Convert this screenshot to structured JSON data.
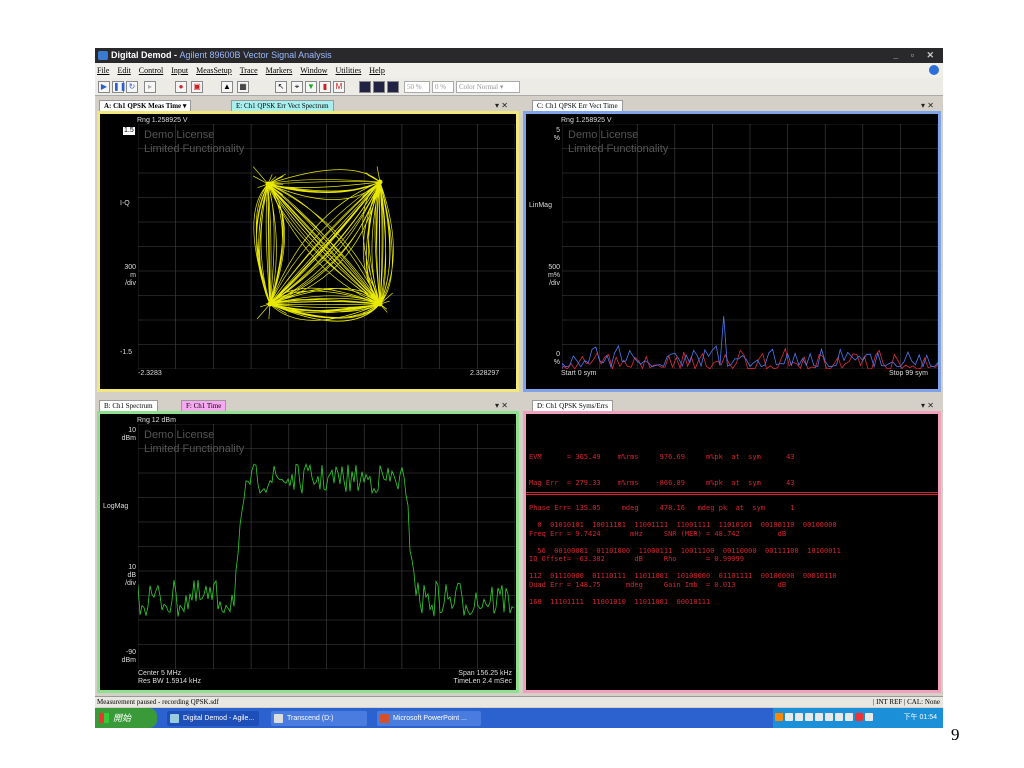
{
  "window": {
    "title": "Digital Demod",
    "app": "Agilent 89600B Vector Signal Analysis"
  },
  "menu": [
    "File",
    "Edit",
    "Control",
    "Input",
    "MeasSetup",
    "Trace",
    "Markers",
    "Window",
    "Utilities",
    "Help"
  ],
  "toolbar": {
    "field1": "50 %",
    "field2": "0 %",
    "color_select": "Color Normal"
  },
  "panelA": {
    "tab_active": "A: Ch1 QPSK Meas Time",
    "tab_other": "E: Ch1 QPSK Err Vect Spectrum",
    "rng": "Rng 1.258925  V",
    "ytop": "1.5",
    "ylabel": "I-Q",
    "scale": [
      "300",
      "m",
      "/div"
    ],
    "ybot": "-1.5",
    "xleft": "-2.3283",
    "xright": "2.328297"
  },
  "panelC": {
    "tab": "C: Ch1 QPSK Err Vect Time",
    "rng": "Rng 1.258925  V",
    "ytop": [
      "5",
      "%"
    ],
    "ylabel": "LinMag",
    "scale": [
      "500",
      "m%",
      "/div"
    ],
    "ybot": [
      "0",
      "%"
    ],
    "xleft": "Start 0  sym",
    "xright": "Stop 99  sym"
  },
  "panelB": {
    "tab_active": "B: Ch1 Spectrum",
    "tab_other": "F: Ch1 Time",
    "rng": "Rng 12 dBm",
    "ytop": [
      "10",
      "dBm"
    ],
    "ylabel": "LogMag",
    "scale": [
      "10",
      "dB",
      "/div"
    ],
    "ybot": [
      "-90",
      "dBm"
    ],
    "center": "Center 5 MHz",
    "resbw": "Res BW 1.5914 kHz",
    "span": "Span 156.25 kHz",
    "timelen": "TimeLen 2.4 mSec"
  },
  "panelD": {
    "tab": "D: Ch1 QPSK Syms/Errs",
    "metrics": [
      "EVM      = 365.49    m%rms     976.69     m%pk  at  sym      43",
      "Mag Err  = 279.33    m%rms    -866.89     m%pk  at  sym      43",
      "Phase Err= 135.05     mdeg     478.16   mdeg pk  at  sym      1",
      "Freq Err = 9.7424       mHz     SNR (MER) = 48.742         dB",
      "IQ Offset= -63.382       dB     Rho       = 0.99999",
      "Quad Err = 148.75      mdeg     Gain Imb  = 0.013          dB"
    ],
    "symbols": [
      "  0  01010101  10011101  11001111  11001111  11010101  00100110  00100000",
      "  56  00100001  01101000  11000111  10011100  00110000  00111100  10100011",
      "112  01110000  01110111  11011001  10100000  01101111  00100000  00010110",
      "168  11101111  11001010  11011001  00010111"
    ]
  },
  "status": {
    "left": "Measurement paused - recording QPSK.sdf",
    "ref": "INT REF",
    "cal": "CAL: None"
  },
  "taskbar": {
    "start": "開始",
    "tasks": [
      "Digital Demod - Agile...",
      "Transcend (D:)",
      "Microsoft PowerPoint ..."
    ],
    "clock": "下午 01:54"
  },
  "page_number": "9",
  "colors": {
    "panelA": "#f1e77f",
    "panelC": "#7fa3e8",
    "panelB": "#8fe08f",
    "panelD": "#f0a0bc",
    "trace_yellow": "#e8e800",
    "trace_green": "#2fd02f",
    "trace_blue": "#4a7af0",
    "trace_red": "#e02a3a"
  }
}
